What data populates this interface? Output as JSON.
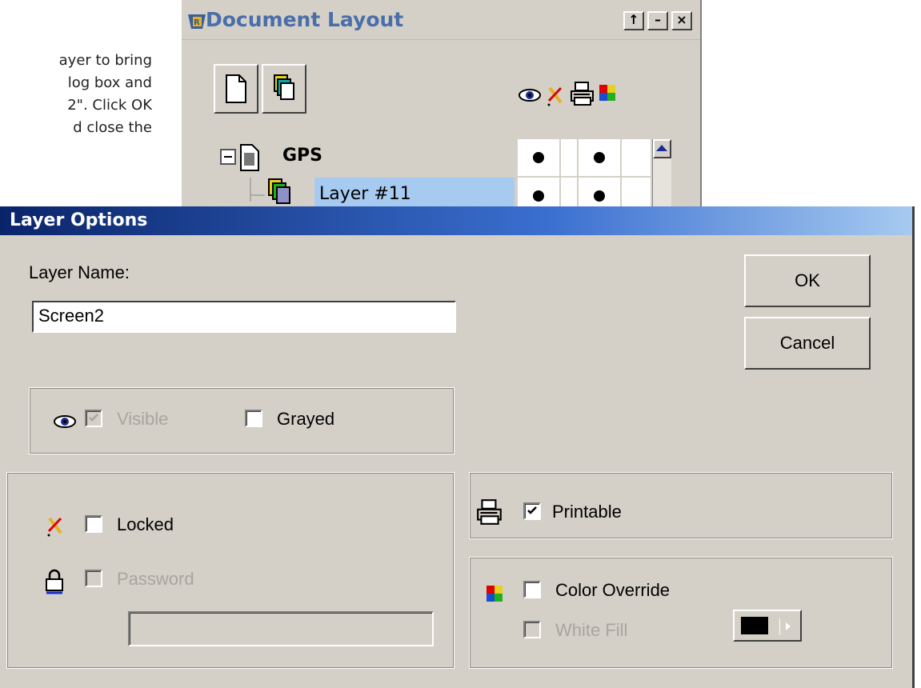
{
  "instructions": {
    "lines": [
      "ayer to bring",
      "log box and",
      "2\". Click OK",
      "d close the"
    ]
  },
  "document_layout": {
    "title": "Document Layout",
    "title_buttons": [
      "↑",
      "–",
      "×"
    ],
    "tree": [
      {
        "name": "GPS",
        "bold": true,
        "selected": false,
        "visible": true,
        "printable": true
      },
      {
        "name": "Layer #11",
        "bold": false,
        "selected": true,
        "visible": true,
        "printable": true
      }
    ],
    "column_icons": [
      "eye-icon",
      "lock-pencil-icon",
      "printer-icon",
      "color-icon"
    ]
  },
  "layer_options": {
    "title": "Layer Options",
    "layer_name_label": "Layer Name:",
    "layer_name_value": "Screen2",
    "ok_label": "OK",
    "cancel_label": "Cancel",
    "visible": {
      "label": "Visible",
      "checked": true,
      "enabled": false
    },
    "grayed": {
      "label": "Grayed",
      "checked": false,
      "enabled": true
    },
    "locked": {
      "label": "Locked",
      "checked": false,
      "enabled": true
    },
    "password": {
      "label": "Password",
      "checked": false,
      "enabled": false,
      "value": ""
    },
    "printable": {
      "label": "Printable",
      "checked": true,
      "enabled": true
    },
    "color_override": {
      "label": "Color Override",
      "checked": false,
      "enabled": true
    },
    "white_fill": {
      "label": "White Fill",
      "checked": false,
      "enabled": false
    },
    "fill_color": "#000000",
    "colors": {
      "title_bar_start": "#0a246a",
      "title_bar_end": "#a6caf0",
      "selection": "#a6caf0",
      "face": "#d4d0c8"
    }
  }
}
